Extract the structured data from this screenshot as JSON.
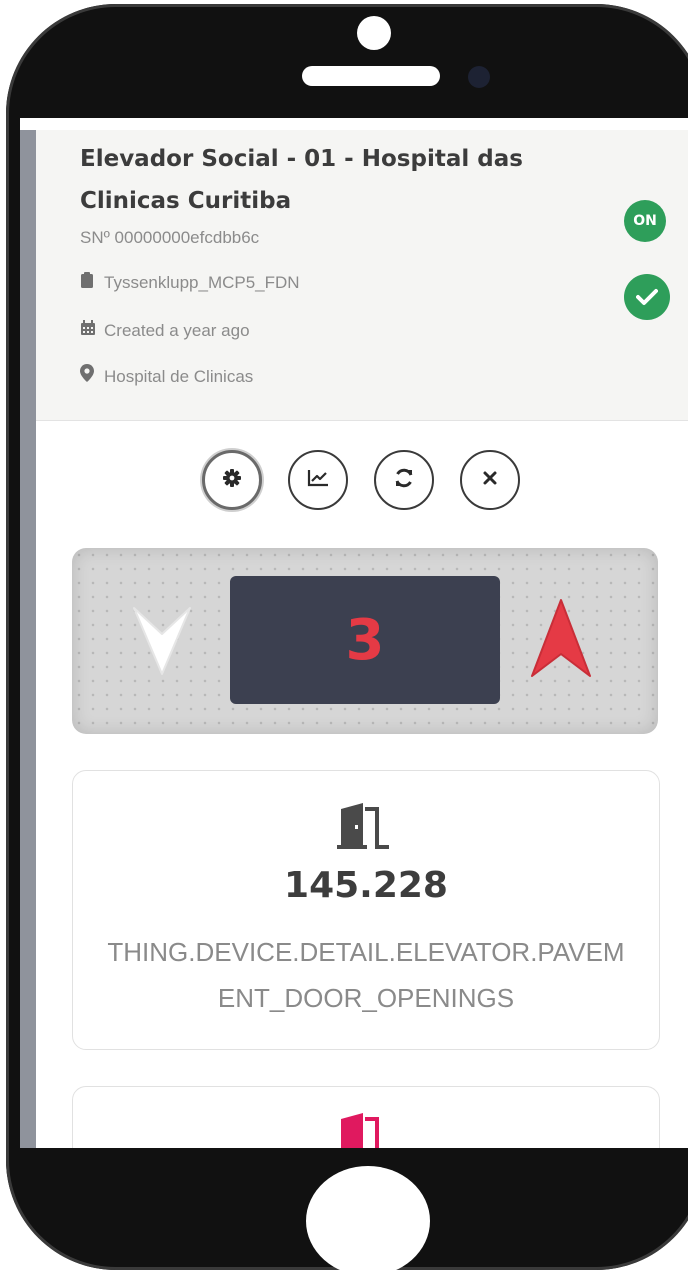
{
  "device": {
    "title": "Elevador Social - 01 - Hospital das Clinicas Curitiba",
    "serial": "SNº 00000000efcdbb6c",
    "model": "Tyssenklupp_MCP5_FDN",
    "created": "Created a year ago",
    "location": "Hospital de Clinicas",
    "status_badge": "ON"
  },
  "actions": [
    {
      "icon": "gear-icon"
    },
    {
      "icon": "chart-icon"
    },
    {
      "icon": "refresh-icon"
    },
    {
      "icon": "close-icon"
    }
  ],
  "elevator": {
    "floor": "3",
    "direction_up_color": "#e53a45",
    "direction_down_color": "#ffffff"
  },
  "stats": [
    {
      "icon": "door-icon",
      "value": "145.228",
      "label": "THING.DEVICE.DETAIL.ELEVATOR.PAVEMENT_DOOR_OPENINGS"
    }
  ],
  "colors": {
    "status_green": "#2e9e5a",
    "accent_red": "#e53a45",
    "accent_pink": "#e0195f"
  }
}
